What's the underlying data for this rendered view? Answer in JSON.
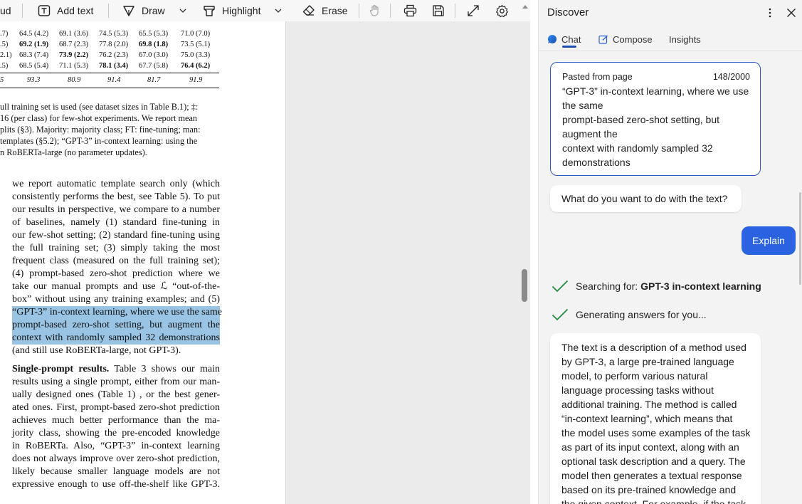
{
  "toolbar": {
    "left_fragment": "ud",
    "add_text": "Add text",
    "draw": "Draw",
    "highlight": "Highlight",
    "erase": "Erase"
  },
  "pdf": {
    "table_rows": [
      {
        "c0": ".7)",
        "c1": "64.5 (4.2)",
        "c2": "69.1 (3.6)",
        "c3": "74.5 (5.3)",
        "c4": "65.5 (5.3)",
        "c5": "71.0 (7.0)",
        "bold": []
      },
      {
        "c0": ".5)",
        "c1": "69.2 (1.9)",
        "c2": "68.7 (2.3)",
        "c3": "77.8 (2.0)",
        "c4": "69.8 (1.8)",
        "c5": "73.5 (5.1)",
        "bold": [
          "c1",
          "c4"
        ]
      },
      {
        "c0": "2.1)",
        "c1": "68.3 (7.4)",
        "c2": "73.9 (2.2)",
        "c3": "76.2 (2.3)",
        "c4": "67.0 (3.0)",
        "c5": "75.0 (3.3)",
        "bold": [
          "c2"
        ]
      },
      {
        "c0": ".5)",
        "c1": "68.5 (5.4)",
        "c2": "71.1 (5.3)",
        "c3": "78.1 (3.4)",
        "c4": "67.7 (5.8)",
        "c5": "76.4 (6.2)",
        "bold": [
          "c3",
          "c5"
        ]
      }
    ],
    "table_last_row": {
      "c0": "5",
      "c1": "93.3",
      "c2": "80.9",
      "c3": "91.4",
      "c4": "81.7",
      "c5": "91.9"
    },
    "caption_lines": [
      "ull training set is used (see dataset sizes in Table B.1); ‡:",
      " 16 (per class) for few-shot experiments.  We report mean",
      "plits (§3).  Majority: majority class; FT: fine-tuning; man:",
      " templates (§5.2); “GPT-3” in-context learning: using the",
      "n RoBERTa-large (no parameter updates)."
    ],
    "para1_lines": [
      "we report automatic template search only (which",
      "consistently performs the best, see Table 5). To put",
      "our results in perspective, we compare to a number",
      "of baselines, namely (1) standard fine-tuning in",
      "our few-shot setting; (2) standard fine-tuning using",
      "the full training set; (3) simply taking the most",
      "frequent class (measured on the full training set);",
      "(4) prompt-based zero-shot prediction where we",
      "take our manual prompts and use ℒ “out-of-the-",
      "box” without using any training examples; and (5)"
    ],
    "para1_highlight_lines": [
      "“GPT-3” in-context learning, where we use the same",
      "prompt-based zero-shot setting, but augment the",
      "context with randomly sampled 32 demonstrations"
    ],
    "para1_tail": "(and still use RoBERTa-large, not GPT-3).",
    "para2_heading": "Single-prompt results.",
    "para2_first_rest": " Table 3 shows our main",
    "para2_lines": [
      "results using a single prompt, either from our man-",
      "ually designed ones (Table 1) , or the best gener-",
      "ated ones. First, prompt-based zero-shot prediction",
      "achieves much better performance than the ma-",
      "jority class, showing the pre-encoded knowledge",
      "in RoBERTa. Also, “GPT-3” in-context learning",
      "does not always improve over zero-shot prediction,",
      "likely because smaller language models are not",
      "expressive enough to use off-the-shelf like GPT-3."
    ]
  },
  "discover": {
    "title": "Discover",
    "tabs": [
      "Chat",
      "Compose",
      "Insights"
    ],
    "pasted": {
      "label": "Pasted from page",
      "count": "148/2000",
      "lines": [
        "“GPT-3” in-context learning, where we use",
        "the same",
        "prompt-based zero-shot setting, but",
        "augment the",
        "context with randomly sampled 32",
        "demonstrations"
      ]
    },
    "prompt": "What do you want to do with the text?",
    "explain_label": "Explain",
    "status1_prefix": "Searching for: ",
    "status1_query": "GPT-3 in-context learning",
    "status2": "Generating answers for you...",
    "answer_lines": [
      "The text is a description of a method used",
      "by GPT-3, a large pre-trained language",
      "model, to perform various natural",
      "language processing tasks without",
      "additional training. The method is called",
      "“in-context learning”, which means that",
      "the model uses some examples of the task",
      "as part of its input context, along with an",
      "optional task description and a query. The",
      "model then generates a textual response",
      "based on its pre-trained knowledge and",
      "the given context. For example, if the task"
    ],
    "accent_color": "#2b62e2",
    "check_color": "#1e8e3e"
  }
}
